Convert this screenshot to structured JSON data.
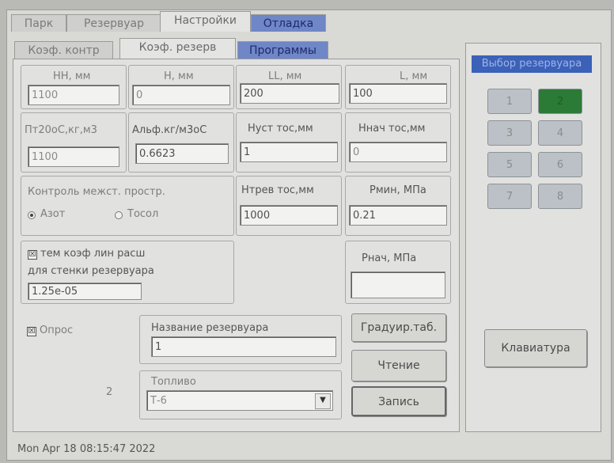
{
  "top_tabs": [
    {
      "label": "Парк"
    },
    {
      "label": "Резервуар"
    },
    {
      "label": "Настройки"
    },
    {
      "label": "Отладка"
    }
  ],
  "sub_tabs": [
    {
      "label": "Коэф. контр"
    },
    {
      "label": "Коэф. резерв"
    },
    {
      "label": "Программы"
    }
  ],
  "fields": {
    "hn": {
      "label": "НН, мм",
      "value": "1100"
    },
    "h": {
      "label": "Н, мм",
      "value": "0"
    },
    "ll": {
      "label": "LL, мм",
      "value": "200"
    },
    "l": {
      "label": "L, мм",
      "value": "100"
    },
    "pt20": {
      "label": "Пт20оС,кг,м3",
      "value": "1100"
    },
    "alpha": {
      "label": "Альф.кг/м3оС",
      "value": "0.6623"
    },
    "nust": {
      "label": "Нуст тос,мм",
      "value": "1"
    },
    "nnach": {
      "label": "Ннач тос,мм",
      "value": "0"
    },
    "ntrev": {
      "label": "Нтрев тос,мм",
      "value": "1000"
    },
    "pmin": {
      "label": "Рмин, МПа",
      "value": "0.21"
    },
    "pnach": {
      "label": "Рнач, МПа",
      "value": ""
    }
  },
  "control": {
    "title": "Контроль межст. простр.",
    "opt1": "Азот",
    "opt2": "Тосол"
  },
  "temp_coef": {
    "check": "☒",
    "line1": "тем коэф лин расш",
    "line2": "для стенки резервуара",
    "value": "1.25e-05"
  },
  "opros": {
    "check": "☒",
    "label": "Опрос"
  },
  "tank_name": {
    "label": "Название резервуара",
    "value": "1"
  },
  "fuel": {
    "label": "Топливо",
    "value": "Т-6",
    "index": "2"
  },
  "buttons": {
    "grad": "Градуир.таб.",
    "read": "Чтение",
    "write": "Запись",
    "keyboard": "Клавиатура"
  },
  "tank_select": {
    "title": "Выбор резервуара",
    "items": [
      "1",
      "2",
      "3",
      "4",
      "5",
      "6",
      "7",
      "8"
    ],
    "selected": "2"
  },
  "status_text": "Mon Apr 18 08:15:47 2022",
  "colors": {
    "selected_tank": "#2b7a36",
    "title_blue": "#3b61b8"
  }
}
